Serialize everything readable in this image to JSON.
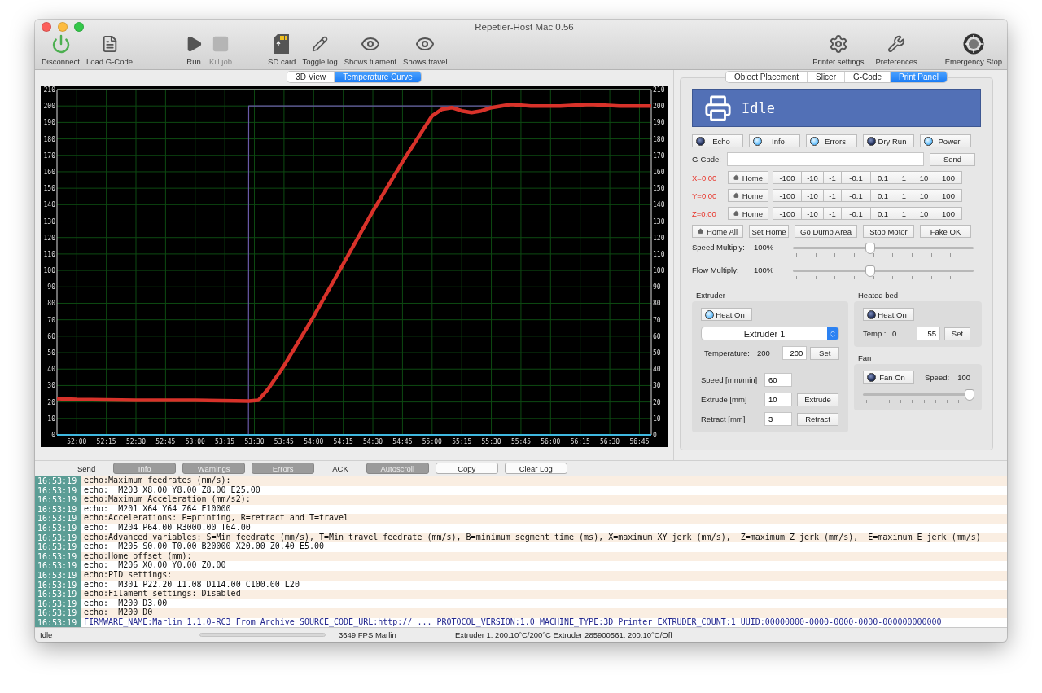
{
  "window": {
    "title": "Repetier-Host Mac 0.56"
  },
  "toolbar": {
    "left_groups": [
      [
        {
          "label": "Disconnect",
          "disabled": false
        },
        {
          "label": "Load G-Code",
          "disabled": false
        }
      ],
      [
        {
          "label": "Run",
          "disabled": false
        },
        {
          "label": "Kill job",
          "disabled": true
        }
      ],
      [
        {
          "label": "SD card",
          "disabled": false
        },
        {
          "label": "Toggle log",
          "disabled": false
        },
        {
          "label": "Shows filament",
          "disabled": false
        },
        {
          "label": "Shows travel",
          "disabled": false
        }
      ]
    ],
    "right": [
      {
        "label": "Printer settings",
        "disabled": false
      },
      {
        "label": "Preferences",
        "disabled": false
      },
      {
        "label": "Emergency Stop",
        "disabled": false
      }
    ]
  },
  "view_tabs": [
    {
      "label": "3D View",
      "selected": false
    },
    {
      "label": "Temperature Curve",
      "selected": true
    }
  ],
  "temperature_chart": {
    "chart_data": {
      "type": "line",
      "x": [
        3110,
        3120,
        3150,
        3180,
        3207,
        3207.1,
        3212,
        3217,
        3225,
        3240,
        3255,
        3270,
        3285,
        3300,
        3305,
        3310,
        3315,
        3320,
        3325,
        3330,
        3340,
        3350,
        3365,
        3380,
        3395,
        3411
      ],
      "series": [
        {
          "color": "#6a5aa8",
          "values": [
            0,
            0,
            0,
            0,
            0,
            200,
            200,
            200,
            200,
            200,
            200,
            200,
            200,
            200,
            200,
            200,
            200,
            200,
            200,
            200,
            null,
            null,
            null,
            null,
            null,
            null
          ]
        },
        {
          "color": "#d8322a",
          "values": [
            22,
            21.5,
            21,
            21,
            20.5,
            20.5,
            21,
            28,
            42,
            72,
            104,
            136,
            166,
            194,
            198,
            199,
            197,
            196,
            197,
            199,
            201,
            200,
            200,
            201,
            200,
            200
          ]
        },
        {
          "color": "#3fb8e0",
          "values": [
            0,
            0,
            0,
            0,
            0,
            0,
            0,
            0,
            0,
            0,
            0,
            0,
            0,
            0,
            0,
            0,
            0,
            0,
            0,
            0,
            0,
            0,
            0,
            0,
            0,
            0
          ]
        }
      ],
      "grid": true,
      "xlim": [
        3110,
        3411
      ],
      "ylim": [
        0,
        210
      ],
      "xticks": [
        {
          "value": 3120,
          "label": "52:00"
        },
        {
          "value": 3135,
          "label": "52:15"
        },
        {
          "value": 3150,
          "label": "52:30"
        },
        {
          "value": 3165,
          "label": "52:45"
        },
        {
          "value": 3180,
          "label": "53:00"
        },
        {
          "value": 3195,
          "label": "53:15"
        },
        {
          "value": 3210,
          "label": "53:30"
        },
        {
          "value": 3225,
          "label": "53:45"
        },
        {
          "value": 3240,
          "label": "54:00"
        },
        {
          "value": 3255,
          "label": "54:15"
        },
        {
          "value": 3270,
          "label": "54:30"
        },
        {
          "value": 3285,
          "label": "54:45"
        },
        {
          "value": 3300,
          "label": "55:00"
        },
        {
          "value": 3315,
          "label": "55:15"
        },
        {
          "value": 3330,
          "label": "55:30"
        },
        {
          "value": 3345,
          "label": "55:45"
        },
        {
          "value": 3360,
          "label": "56:00"
        },
        {
          "value": 3375,
          "label": "56:15"
        },
        {
          "value": 3390,
          "label": "56:30"
        },
        {
          "value": 3405,
          "label": "56:45"
        }
      ],
      "yticks": [
        0,
        10,
        20,
        30,
        40,
        50,
        60,
        70,
        80,
        90,
        100,
        110,
        120,
        130,
        140,
        150,
        160,
        170,
        180,
        190,
        200,
        210
      ]
    },
    "right_axis_labels": [
      "210",
      "200",
      "190",
      "180",
      "170",
      "160",
      "150",
      "140",
      "130",
      "120",
      "110",
      "100",
      "90",
      "80",
      "70",
      "60",
      "50",
      "40",
      "30",
      "20",
      "10",
      "0"
    ]
  },
  "panel_tabs": [
    {
      "label": "Object Placement",
      "selected": false
    },
    {
      "label": "Slicer",
      "selected": false
    },
    {
      "label": "G-Code",
      "selected": false
    },
    {
      "label": "Print Panel",
      "selected": true
    }
  ],
  "status_banner": {
    "text": "Idle"
  },
  "toggles": [
    {
      "label": "Echo",
      "on": false
    },
    {
      "label": "Info",
      "on": true
    },
    {
      "label": "Errors",
      "on": true
    },
    {
      "label": "Dry Run",
      "on": false
    },
    {
      "label": "Power",
      "on": true
    }
  ],
  "gcode": {
    "label": "G-Code:",
    "button": "Send"
  },
  "axes": [
    {
      "label": "X=0.00",
      "home": "Home",
      "steps": [
        "-100",
        "-10",
        "-1",
        "-0.1",
        "0.1",
        "1",
        "10",
        "100"
      ]
    },
    {
      "label": "Y=0.00",
      "home": "Home",
      "steps": [
        "-100",
        "-10",
        "-1",
        "-0.1",
        "0.1",
        "1",
        "10",
        "100"
      ]
    },
    {
      "label": "Z=0.00",
      "home": "Home",
      "steps": [
        "-100",
        "-10",
        "-1",
        "-0.1",
        "0.1",
        "1",
        "10",
        "100"
      ]
    }
  ],
  "actions": [
    "Home All",
    "Set Home",
    "Go Dump Area",
    "Stop Motor",
    "Fake OK"
  ],
  "multipliers": [
    {
      "label": "Speed Multiply:",
      "value": "100%",
      "level": 0.43
    },
    {
      "label": "Flow Multiply:",
      "value": "100%",
      "level": 0.43
    }
  ],
  "extruder": {
    "title": "Extruder",
    "heat": {
      "label": "Heat On",
      "on": true
    },
    "select": "Extruder 1",
    "temperature": {
      "label": "Temperature:",
      "current": "200",
      "target": "200",
      "button": "Set"
    },
    "speed": {
      "label": "Speed [mm/min]",
      "value": "60"
    },
    "extrude": {
      "label": "Extrude [mm]",
      "value": "10",
      "button": "Extrude"
    },
    "retract": {
      "label": "Retract [mm]",
      "value": "3",
      "button": "Retract"
    }
  },
  "bed": {
    "title": "Heated bed",
    "heat": {
      "label": "Heat On",
      "on": false
    },
    "temp_label": "Temp.:",
    "current": "0",
    "target": "55",
    "button": "Set"
  },
  "fan": {
    "title": "Fan",
    "toggle": {
      "label": "Fan On",
      "on": false
    },
    "speed_label": "Speed:",
    "speed": "100",
    "level": 0.96
  },
  "log_toolbar": [
    {
      "label": "Send",
      "kind": "toggle",
      "on": false
    },
    {
      "label": "Info",
      "kind": "toggle",
      "on": true
    },
    {
      "label": "Warnings",
      "kind": "toggle",
      "on": true
    },
    {
      "label": "Errors",
      "kind": "toggle",
      "on": true
    },
    {
      "label": "ACK",
      "kind": "toggle",
      "on": false
    },
    {
      "label": "Autoscroll",
      "kind": "toggle",
      "on": true
    },
    {
      "label": "Copy",
      "kind": "button"
    },
    {
      "label": "Clear Log",
      "kind": "button"
    }
  ],
  "log": [
    {
      "time": "16:53:19",
      "text": "echo:Maximum feedrates (mm/s):",
      "kind": "echo"
    },
    {
      "time": "16:53:19",
      "text": "echo:  M203 X8.00 Y8.00 Z8.00 E25.00",
      "kind": "echo"
    },
    {
      "time": "16:53:19",
      "text": "echo:Maximum Acceleration (mm/s2):",
      "kind": "echo"
    },
    {
      "time": "16:53:19",
      "text": "echo:  M201 X64 Y64 Z64 E10000",
      "kind": "echo"
    },
    {
      "time": "16:53:19",
      "text": "echo:Accelerations: P=printing, R=retract and T=travel",
      "kind": "echo"
    },
    {
      "time": "16:53:19",
      "text": "echo:  M204 P64.00 R3000.00 T64.00",
      "kind": "echo"
    },
    {
      "time": "16:53:19",
      "text": "echo:Advanced variables: S=Min feedrate (mm/s), T=Min travel feedrate (mm/s), B=minimum segment time (ms), X=maximum XY jerk (mm/s),  Z=maximum Z jerk (mm/s),  E=maximum E jerk (mm/s)",
      "kind": "echo"
    },
    {
      "time": "16:53:19",
      "text": "echo:  M205 S0.00 T0.00 B20000 X20.00 Z0.40 E5.00",
      "kind": "echo"
    },
    {
      "time": "16:53:19",
      "text": "echo:Home offset (mm):",
      "kind": "echo"
    },
    {
      "time": "16:53:19",
      "text": "echo:  M206 X0.00 Y0.00 Z0.00",
      "kind": "echo"
    },
    {
      "time": "16:53:19",
      "text": "echo:PID settings:",
      "kind": "echo"
    },
    {
      "time": "16:53:19",
      "text": "echo:  M301 P22.20 I1.08 D114.00 C100.00 L20",
      "kind": "echo"
    },
    {
      "time": "16:53:19",
      "text": "echo:Filament settings: Disabled",
      "kind": "echo"
    },
    {
      "time": "16:53:19",
      "text": "echo:  M200 D3.00",
      "kind": "echo"
    },
    {
      "time": "16:53:19",
      "text": "echo:  M200 D0",
      "kind": "echo"
    },
    {
      "time": "16:53:19",
      "text": "FIRMWARE_NAME:Marlin 1.1.0-RC3 From Archive SOURCE_CODE_URL:http:// ... PROTOCOL_VERSION:1.0 MACHINE_TYPE:3D Printer EXTRUDER_COUNT:1 UUID:00000000-0000-0000-0000-000000000000",
      "kind": "firmware"
    }
  ],
  "status_bar": {
    "state": "Idle",
    "level": 0,
    "fps": "3649 FPS Marlin",
    "temps": "Extruder 1: 200.10°C/200°C Extruder 285900561: 200.10°C/Off"
  }
}
